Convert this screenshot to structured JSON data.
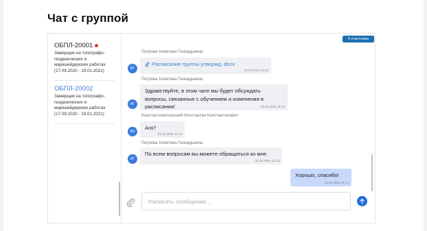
{
  "page": {
    "title": "Чат с группой"
  },
  "sidebar": {
    "groups": [
      {
        "title": "ОБПЛ-20001",
        "unread": true,
        "description": "Замерщик на топографо-геодезических и маркшейдерских работах (17.09.2020 - 19.01.2021)"
      },
      {
        "title": "ОБПЛ-20002",
        "unread": false,
        "description": "Замерщик на топографо-геодезических и маркшейдерских работах  (17.09.2020 - 19.01.2021)"
      }
    ]
  },
  "chat": {
    "members_badge": "4 участника",
    "messages": [
      {
        "sender": "Петрова Алевтина Геннадьевна",
        "avatar": "АГ",
        "text": "Расписание группы утвержд. docx",
        "is_file": true,
        "time": "21.01.2021 11:11"
      },
      {
        "sender": "Петрова Алевтина Геннадьевна",
        "avatar": "АГ",
        "text": "Здравствуйте, в этом чате мы будет обсуждать вопросы, связанные с обучением и изменения в расписании!",
        "time": "21.01.2021 11:11"
      },
      {
        "sender": "Константинопольский Константин Константинович",
        "avatar": "КК",
        "text": "Ага?",
        "time": "21.01.2021 11:12"
      },
      {
        "sender": "Петрова Алевтина Геннадьевна",
        "avatar": "АГ",
        "text": "По всем вопросам вы можете обращаться ко мне",
        "time": "21.01.2021 11:13"
      },
      {
        "sender": "",
        "avatar": "",
        "own": true,
        "text": "Хорошо, спасибо!",
        "time": "21.01.2021 11:14"
      }
    ],
    "input": {
      "placeholder": "Написать сообщение...",
      "value": ""
    }
  },
  "icons": {
    "attach": "paperclip-icon",
    "send": "arrow-up-icon",
    "file": "paperclip-icon"
  },
  "colors": {
    "accent": "#1f6fde",
    "own_bubble": "#c9d9fb",
    "incoming_bubble": "#eef0f3",
    "badge": "#1b6fb0",
    "unread_dot": "#e53935",
    "link": "#3f7fd0"
  }
}
